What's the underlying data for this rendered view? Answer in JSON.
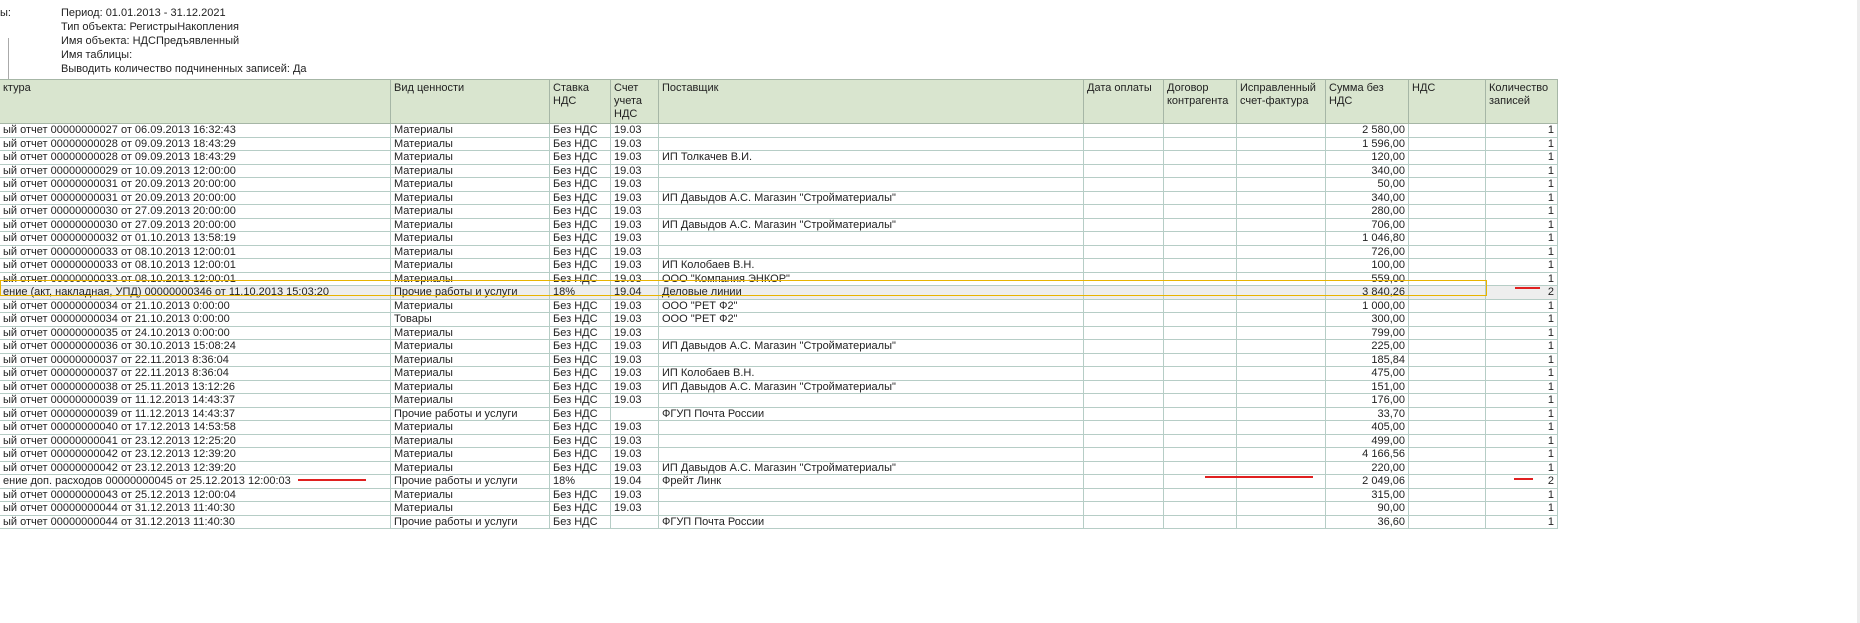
{
  "params": {
    "label": "ы:",
    "lines": [
      "Период: 01.01.2013 - 31.12.2021",
      "Тип объекта: РегистрыНакопления",
      "Имя объекта: НДСПредъявленный",
      "Имя таблицы:",
      "Выводить количество подчиненных записей: Да"
    ]
  },
  "columns": [
    "ктура",
    "Вид ценности",
    "Ставка НДС",
    "Счет учета НДС",
    "Поставщик",
    "Дата оплаты",
    "Договор контрагента",
    "Исправленный счет-фактура",
    "Сумма без НДС",
    "НДС",
    "Количество записей"
  ],
  "rows": [
    [
      "ый отчет 00000000027 от 06.09.2013 16:32:43",
      "Материалы",
      "Без НДС",
      "19.03",
      "",
      "",
      "",
      "",
      "2 580,00",
      "",
      "1"
    ],
    [
      "ый отчет 00000000028 от 09.09.2013 18:43:29",
      "Материалы",
      "Без НДС",
      "19.03",
      "",
      "",
      "",
      "",
      "1 596,00",
      "",
      "1"
    ],
    [
      "ый отчет 00000000028 от 09.09.2013 18:43:29",
      "Материалы",
      "Без НДС",
      "19.03",
      "ИП Толкачев В.И.",
      "",
      "",
      "",
      "120,00",
      "",
      "1"
    ],
    [
      "ый отчет 00000000029 от 10.09.2013 12:00:00",
      "Материалы",
      "Без НДС",
      "19.03",
      "",
      "",
      "",
      "",
      "340,00",
      "",
      "1"
    ],
    [
      "ый отчет 00000000031 от 20.09.2013 20:00:00",
      "Материалы",
      "Без НДС",
      "19.03",
      "",
      "",
      "",
      "",
      "50,00",
      "",
      "1"
    ],
    [
      "ый отчет 00000000031 от 20.09.2013 20:00:00",
      "Материалы",
      "Без НДС",
      "19.03",
      "ИП Давыдов А.С. Магазин \"Стройматериалы\"",
      "",
      "",
      "",
      "340,00",
      "",
      "1"
    ],
    [
      "ый отчет 00000000030 от 27.09.2013 20:00:00",
      "Материалы",
      "Без НДС",
      "19.03",
      "",
      "",
      "",
      "",
      "280,00",
      "",
      "1"
    ],
    [
      "ый отчет 00000000030 от 27.09.2013 20:00:00",
      "Материалы",
      "Без НДС",
      "19.03",
      "ИП Давыдов А.С. Магазин \"Стройматериалы\"",
      "",
      "",
      "",
      "706,00",
      "",
      "1"
    ],
    [
      "ый отчет 00000000032 от 01.10.2013 13:58:19",
      "Материалы",
      "Без НДС",
      "19.03",
      "",
      "",
      "",
      "",
      "1 046,80",
      "",
      "1"
    ],
    [
      "ый отчет 00000000033 от 08.10.2013 12:00:01",
      "Материалы",
      "Без НДС",
      "19.03",
      "",
      "",
      "",
      "",
      "726,00",
      "",
      "1"
    ],
    [
      "ый отчет 00000000033 от 08.10.2013 12:00:01",
      "Материалы",
      "Без НДС",
      "19.03",
      "ИП Колобаев В.Н.",
      "",
      "",
      "",
      "100,00",
      "",
      "1"
    ],
    [
      "ый отчет 00000000033 от 08.10.2013 12:00:01",
      "Материалы",
      "Без НДС",
      "19.03",
      "ООО \"Компания ЭНКОР\"",
      "",
      "",
      "",
      "559,00",
      "",
      "1"
    ],
    [
      "ение (акт, накладная, УПД) 00000000346 от 11.10.2013 15:03:20",
      "Прочие работы и услуги",
      "18%",
      "19.04",
      "Деловые линии",
      "",
      "",
      "",
      "3 840,26",
      "",
      "2"
    ],
    [
      "ый отчет 00000000034 от 21.10.2013 0:00:00",
      "Материалы",
      "Без НДС",
      "19.03",
      "ООО \"РЕТ Ф2\"",
      "",
      "",
      "",
      "1 000,00",
      "",
      "1"
    ],
    [
      "ый отчет 00000000034 от 21.10.2013 0:00:00",
      "Товары",
      "Без НДС",
      "19.03",
      "ООО \"РЕТ Ф2\"",
      "",
      "",
      "",
      "300,00",
      "",
      "1"
    ],
    [
      "ый отчет 00000000035 от 24.10.2013 0:00:00",
      "Материалы",
      "Без НДС",
      "19.03",
      "",
      "",
      "",
      "",
      "799,00",
      "",
      "1"
    ],
    [
      "ый отчет 00000000036 от 30.10.2013 15:08:24",
      "Материалы",
      "Без НДС",
      "19.03",
      "ИП Давыдов А.С. Магазин \"Стройматериалы\"",
      "",
      "",
      "",
      "225,00",
      "",
      "1"
    ],
    [
      "ый отчет 00000000037 от 22.11.2013 8:36:04",
      "Материалы",
      "Без НДС",
      "19.03",
      "",
      "",
      "",
      "",
      "185,84",
      "",
      "1"
    ],
    [
      "ый отчет 00000000037 от 22.11.2013 8:36:04",
      "Материалы",
      "Без НДС",
      "19.03",
      "ИП Колобаев В.Н.",
      "",
      "",
      "",
      "475,00",
      "",
      "1"
    ],
    [
      "ый отчет 00000000038 от 25.11.2013 13:12:26",
      "Материалы",
      "Без НДС",
      "19.03",
      "ИП Давыдов А.С. Магазин \"Стройматериалы\"",
      "",
      "",
      "",
      "151,00",
      "",
      "1"
    ],
    [
      "ый отчет 00000000039 от 11.12.2013 14:43:37",
      "Материалы",
      "Без НДС",
      "19.03",
      "",
      "",
      "",
      "",
      "176,00",
      "",
      "1"
    ],
    [
      "ый отчет 00000000039 от 11.12.2013 14:43:37",
      "Прочие работы и услуги",
      "Без НДС",
      "",
      "ФГУП Почта России",
      "",
      "",
      "",
      "33,70",
      "",
      "1"
    ],
    [
      "ый отчет 00000000040 от 17.12.2013 14:53:58",
      "Материалы",
      "Без НДС",
      "19.03",
      "",
      "",
      "",
      "",
      "405,00",
      "",
      "1"
    ],
    [
      "ый отчет 00000000041 от 23.12.2013 12:25:20",
      "Материалы",
      "Без НДС",
      "19.03",
      "",
      "",
      "",
      "",
      "499,00",
      "",
      "1"
    ],
    [
      "ый отчет 00000000042 от 23.12.2013 12:39:20",
      "Материалы",
      "Без НДС",
      "19.03",
      "",
      "",
      "",
      "",
      "4 166,56",
      "",
      "1"
    ],
    [
      "ый отчет 00000000042 от 23.12.2013 12:39:20",
      "Материалы",
      "Без НДС",
      "19.03",
      "ИП Давыдов А.С. Магазин \"Стройматериалы\"",
      "",
      "",
      "",
      "220,00",
      "",
      "1"
    ],
    [
      "ение доп. расходов 00000000045 от 25.12.2013 12:00:03",
      "Прочие работы и услуги",
      "18%",
      "19.04",
      "Фрейт Линк",
      "",
      "",
      "",
      "2 049,06",
      "",
      "2"
    ],
    [
      "ый отчет 00000000043 от 25.12.2013 12:00:04",
      "Материалы",
      "Без НДС",
      "19.03",
      "",
      "",
      "",
      "",
      "315,00",
      "",
      "1"
    ],
    [
      "ый отчет 00000000044 от 31.12.2013 11:40:30",
      "Материалы",
      "Без НДС",
      "19.03",
      "",
      "",
      "",
      "",
      "90,00",
      "",
      "1"
    ],
    [
      "ый отчет 00000000044 от 31.12.2013 11:40:30",
      "Прочие работы и услуги",
      "Без НДС",
      "",
      "ФГУП Почта России",
      "",
      "",
      "",
      "36,60",
      "",
      "1"
    ]
  ],
  "selected_row": 12,
  "colors": {
    "header_bg": "#d9e5cf",
    "highlight": "#e8b400",
    "annotation": "#e02020"
  }
}
